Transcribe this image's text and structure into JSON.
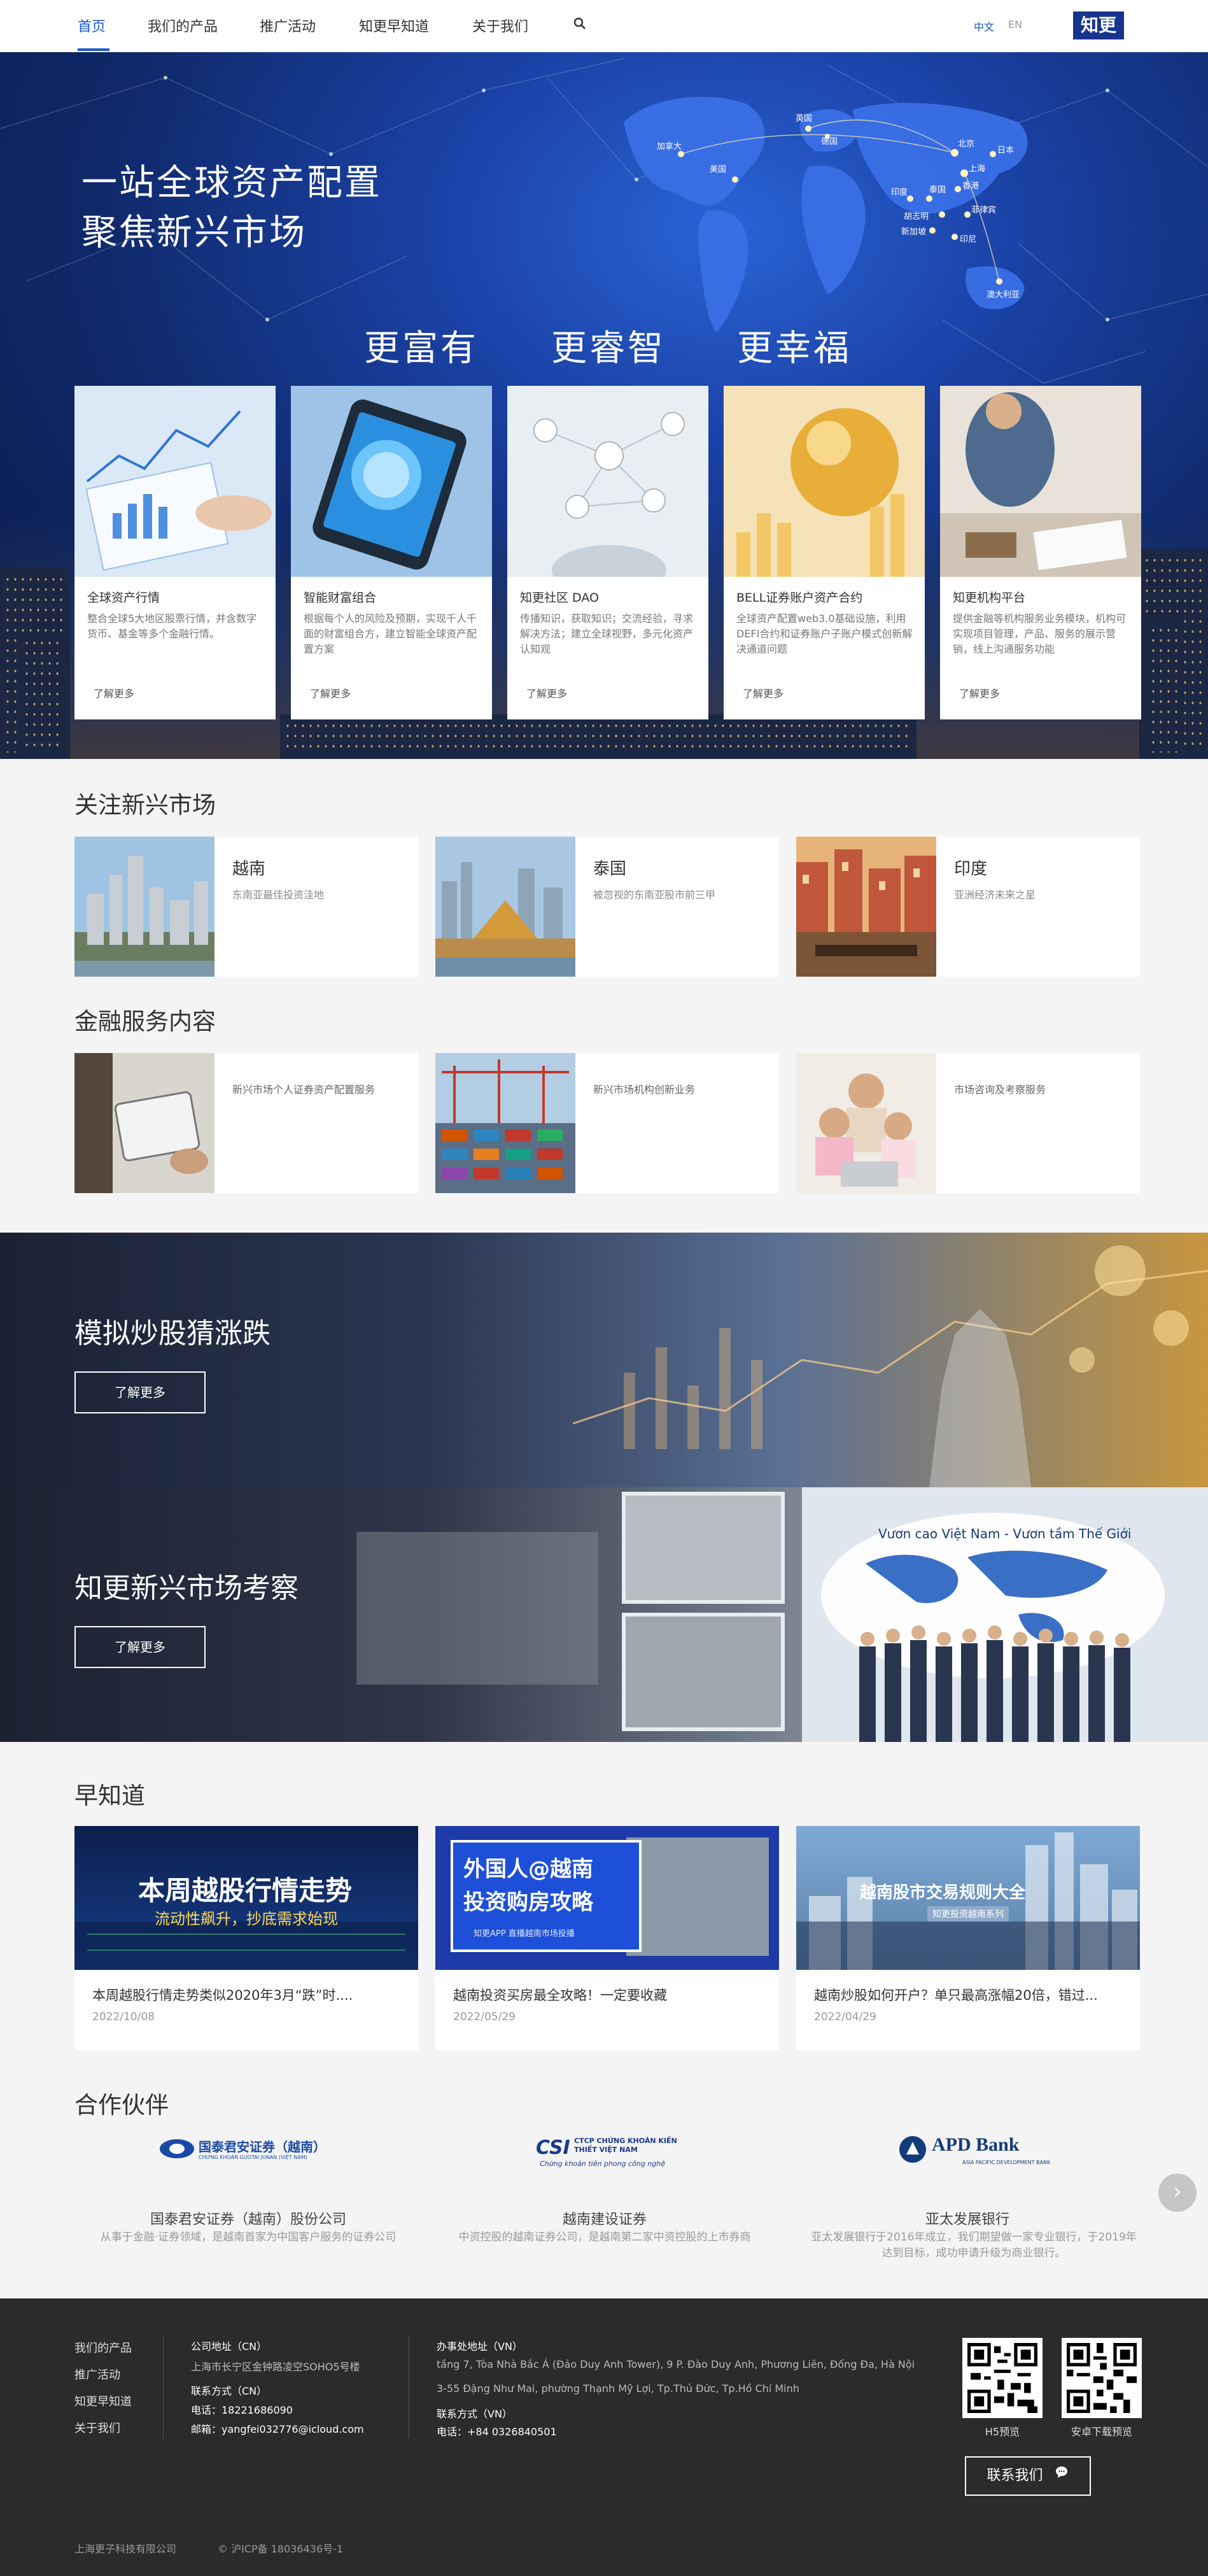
{
  "nav": {
    "items": [
      "首页",
      "我们的产品",
      "推广活动",
      "知更早知道",
      "关于我们"
    ],
    "lang_cn": "中文",
    "lang_en": "EN",
    "logo": "知更"
  },
  "hero": {
    "headline1": "一站全球资产配置",
    "headline2": "聚焦新兴市场",
    "pillars": [
      "更富有",
      "更睿智",
      "更幸福"
    ],
    "map_labels": [
      "加拿大",
      "美国",
      "英国",
      "德国",
      "北京",
      "日本",
      "上海",
      "香港",
      "泰国",
      "胡志明",
      "印度",
      "新加坡",
      "菲律宾",
      "印尼",
      "澳大利亚"
    ],
    "cards": [
      {
        "title": "全球资产行情",
        "desc": "整合全球5大地区股票行情，并含数字货币、基金等多个金融行情。",
        "more": "了解更多"
      },
      {
        "title": "智能财富组合",
        "desc": "根据每个人的风险及预期，实现千人千面的财富组合方，建立智能全球资产配置方案",
        "more": "了解更多"
      },
      {
        "title": "知更社区 DAO",
        "desc": "传播知识，获取知识；交流经验，寻求解决方法；建立全球视野，多元化资产认知观",
        "more": "了解更多"
      },
      {
        "title": "BELL证券账户资产合约",
        "desc": "全球资产配置web3.0基础设施，利用DEFI合约和证券账户子账户模式创新解决通道问题",
        "more": "了解更多"
      },
      {
        "title": "知更机构平台",
        "desc": "提供金融等机构服务业务模块，机构可实现项目管理，产品、服务的展示营销，线上沟通服务功能",
        "more": "了解更多"
      }
    ]
  },
  "emerging": {
    "title": "关注新兴市场",
    "items": [
      {
        "name": "越南",
        "sub": "东南亚最佳投资洼地"
      },
      {
        "name": "泰国",
        "sub": "被忽视的东南亚股市前三甲"
      },
      {
        "name": "印度",
        "sub": "亚洲经济未来之星"
      }
    ]
  },
  "services": {
    "title": "金融服务内容",
    "items": [
      {
        "sub": "新兴市场个人证券资产配置服务"
      },
      {
        "sub": "新兴市场机构创新业务"
      },
      {
        "sub": "市场咨询及考察服务"
      }
    ]
  },
  "banners": [
    {
      "title": "模拟炒股猜涨跌",
      "btn": "了解更多"
    },
    {
      "title": "知更新兴市场考察",
      "btn": "了解更多"
    }
  ],
  "banner2_sign": "Vươn cao Việt Nam - Vươn tầm Thế Giới",
  "news": {
    "title": "早知道",
    "items": [
      {
        "img_line1": "本周越股行情走势",
        "img_line2": "流动性飙升，抄底需求始现",
        "title": "本周越股行情走势类似2020年3月“跌”时....",
        "date": "2022/10/08"
      },
      {
        "img_line1": "外国人@越南",
        "img_line2": "投资购房攻略",
        "img_line3": "知更APP 直播越南市场投播",
        "title": "越南投资买房最全攻略！一定要收藏",
        "date": "2022/05/29"
      },
      {
        "img_line1": "越南股市交易规则大全",
        "img_line2": "知更投资越南系列",
        "title": "越南炒股如何开户？单只最高涨幅20倍，错过...",
        "date": "2022/04/29"
      }
    ]
  },
  "partners": {
    "title": "合作伙伴",
    "items": [
      {
        "logo": "国泰君安证券（越南）",
        "logo_sub": "CHỨNG KHOÁN GUOTAI JUNAN (VIỆT NAM)",
        "name": "国泰君安证券（越南）股份公司",
        "desc": "从事于金融·证券领域，是越南首家为中国客户服务的证券公司"
      },
      {
        "logo": "CTCP CHỨNG KHOÁN KIẾN THIẾT VIỆT NAM",
        "logo_mark": "CSI",
        "logo_sub": "Chứng khoán tiên phong công nghệ",
        "name": "越南建设证券",
        "desc": "中资控股的越南证券公司，是越南第二家中资控股的上市券商"
      },
      {
        "logo": "APD Bank",
        "logo_sub": "ASIA PACIFIC DEVELOPMENT BANK",
        "name": "亚太发展银行",
        "desc": "亚太发展银行于2016年成立，我们期望做一家专业银行，于2019年达到目标，成功申请升级为商业银行。"
      }
    ]
  },
  "footer": {
    "links": [
      "我们的产品",
      "推广活动",
      "知更早知道",
      "关于我们"
    ],
    "cn_addr_label": "公司地址（CN）",
    "cn_addr": "上海市长宁区金钟路凌空SOHO5号楼",
    "cn_contact_label": "联系方式（CN）",
    "cn_phone": "电话：18221686090",
    "cn_email": "邮箱：yangfei032776@icloud.com",
    "vn_addr_label": "办事处地址（VN）",
    "vn_addr1": "tầng 7, Tòa Nhà Bắc Á (Đảo Duy Anh Tower), 9 P. Đào Duy Anh, Phương Liên, Đống Đa, Hà Nội",
    "vn_addr2": "3-55 Đặng Như Mai, phường Thạnh Mỹ Lợi, Tp.Thủ Đức, Tp.Hồ Chí Minh",
    "vn_contact_label": "联系方式（VN）",
    "vn_phone": "电话：+84 0326840501",
    "qr1": "H5预览",
    "qr2": "安卓下载预览",
    "contact_btn": "联系我们",
    "company": "上海更子科技有限公司",
    "icp": "© 沪ICP备 18036436号-1"
  }
}
